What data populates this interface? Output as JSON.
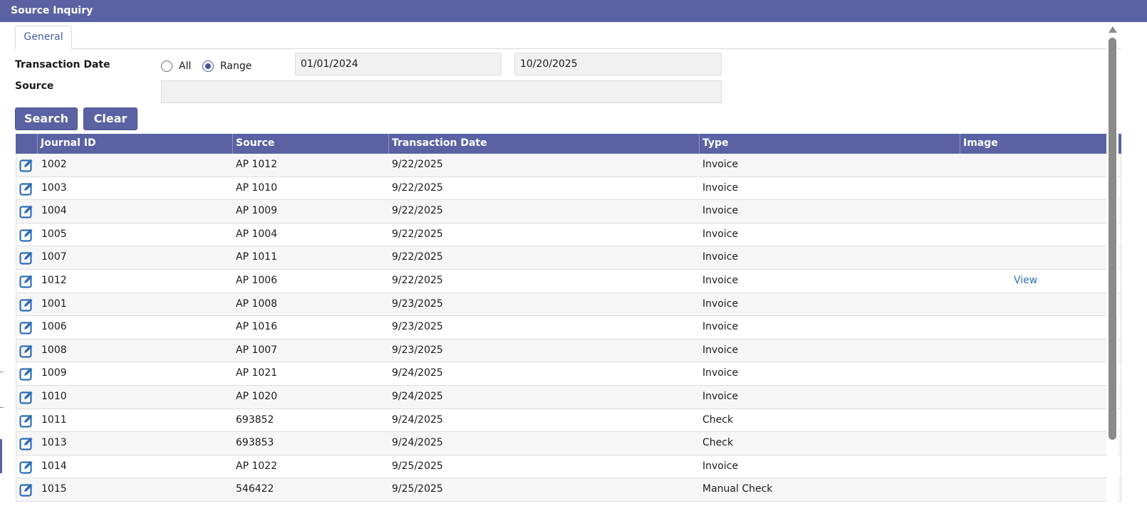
{
  "window": {
    "title": "Source Inquiry"
  },
  "tabs": [
    {
      "label": "General"
    }
  ],
  "filters": {
    "transaction_date_label": "Transaction Date",
    "source_label": "Source",
    "radio_all": {
      "label": "All",
      "checked": false
    },
    "radio_range": {
      "label": "Range",
      "checked": true
    },
    "date_from": "01/01/2024",
    "date_to": "10/20/2025",
    "source_value": ""
  },
  "actions": {
    "search_label": "Search",
    "clear_label": "Clear"
  },
  "grid": {
    "columns": [
      "Journal ID",
      "Source",
      "Transaction Date",
      "Type",
      "Image"
    ],
    "rows": [
      {
        "journal_id": "1002",
        "source": "AP 1012",
        "date": "9/22/2025",
        "type": "Invoice",
        "image": ""
      },
      {
        "journal_id": "1003",
        "source": "AP 1010",
        "date": "9/22/2025",
        "type": "Invoice",
        "image": ""
      },
      {
        "journal_id": "1004",
        "source": "AP 1009",
        "date": "9/22/2025",
        "type": "Invoice",
        "image": ""
      },
      {
        "journal_id": "1005",
        "source": "AP 1004",
        "date": "9/22/2025",
        "type": "Invoice",
        "image": ""
      },
      {
        "journal_id": "1007",
        "source": "AP 1011",
        "date": "9/22/2025",
        "type": "Invoice",
        "image": ""
      },
      {
        "journal_id": "1012",
        "source": "AP 1006",
        "date": "9/22/2025",
        "type": "Invoice",
        "image": "View"
      },
      {
        "journal_id": "1001",
        "source": "AP 1008",
        "date": "9/23/2025",
        "type": "Invoice",
        "image": ""
      },
      {
        "journal_id": "1006",
        "source": "AP 1016",
        "date": "9/23/2025",
        "type": "Invoice",
        "image": ""
      },
      {
        "journal_id": "1008",
        "source": "AP 1007",
        "date": "9/23/2025",
        "type": "Invoice",
        "image": ""
      },
      {
        "journal_id": "1009",
        "source": "AP 1021",
        "date": "9/24/2025",
        "type": "Invoice",
        "image": ""
      },
      {
        "journal_id": "1010",
        "source": "AP 1020",
        "date": "9/24/2025",
        "type": "Invoice",
        "image": ""
      },
      {
        "journal_id": "1011",
        "source": "693852",
        "date": "9/24/2025",
        "type": "Check",
        "image": ""
      },
      {
        "journal_id": "1013",
        "source": "693853",
        "date": "9/24/2025",
        "type": "Check",
        "image": ""
      },
      {
        "journal_id": "1014",
        "source": "AP 1022",
        "date": "9/25/2025",
        "type": "Invoice",
        "image": ""
      },
      {
        "journal_id": "1015",
        "source": "546422",
        "date": "9/25/2025",
        "type": "Manual Check",
        "image": ""
      }
    ]
  },
  "icons": {
    "row_edit": "edit-icon"
  },
  "colors": {
    "header": "#5a62a3",
    "link": "#2f6db5",
    "edit_icon": "#2f6db5"
  }
}
